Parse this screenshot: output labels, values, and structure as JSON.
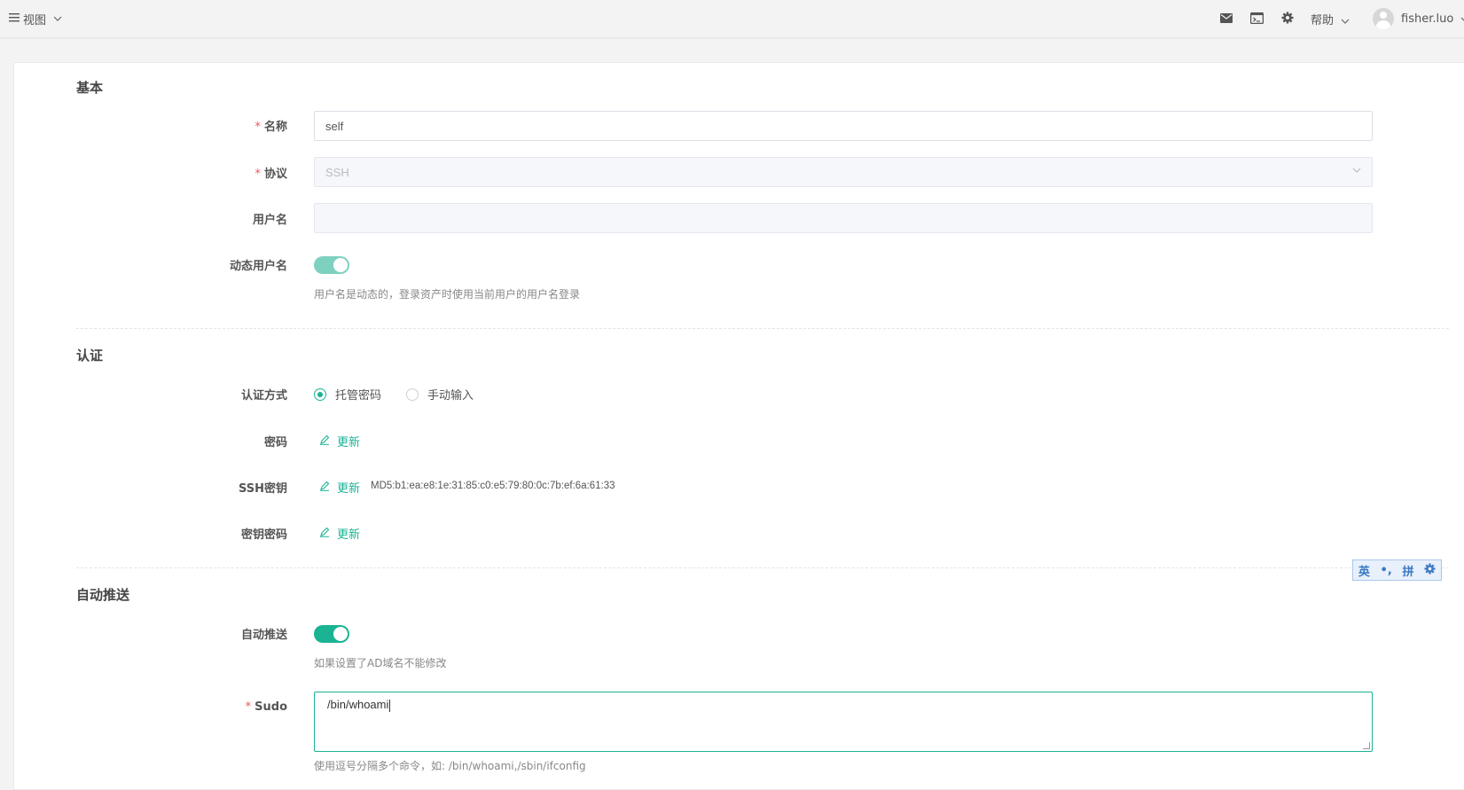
{
  "topbar": {
    "view_label": "视图",
    "help_label": "帮助",
    "username": "fisher.luo"
  },
  "icons": [
    "menu-icon",
    "chevron-down-icon",
    "mail-icon",
    "terminal-icon",
    "gear-icon",
    "avatar"
  ],
  "sections": {
    "basic": "基本",
    "auth": "认证",
    "auto_push": "自动推送"
  },
  "fields": {
    "name_label": "名称",
    "name_value": "self",
    "protocol_label": "协议",
    "protocol_value": "SSH",
    "username_label": "用户名",
    "username_value": "",
    "dynamic_username_label": "动态用户名",
    "dynamic_username_help": "用户名是动态的，登录资产时使用当前用户的用户名登录",
    "dynamic_username_on": true,
    "auth_method_label": "认证方式",
    "auth_method_options": [
      "托管密码",
      "手动输入"
    ],
    "auth_method_selected": "托管密码",
    "password_label": "密码",
    "ssh_key_label": "SSH密钥",
    "ssh_key_md5": "MD5:b1:ea:e8:1e:31:85:c0:e5:79:80:0c:7b:ef:6a:61:33",
    "key_password_label": "密钥密码",
    "update_label": "更新",
    "auto_push_label": "自动推送",
    "auto_push_help": "如果设置了AD域名不能修改",
    "auto_push_on": true,
    "sudo_label": "Sudo",
    "sudo_value": "/bin/whoami",
    "sudo_help": "使用逗号分隔多个命令，如: /bin/whoami,/sbin/ifconfig"
  },
  "ime_toolbar": {
    "lang": "英",
    "punct": "•,",
    "mode": "拼"
  },
  "colors": {
    "accent": "#1ab394",
    "required": "#ed5565"
  }
}
